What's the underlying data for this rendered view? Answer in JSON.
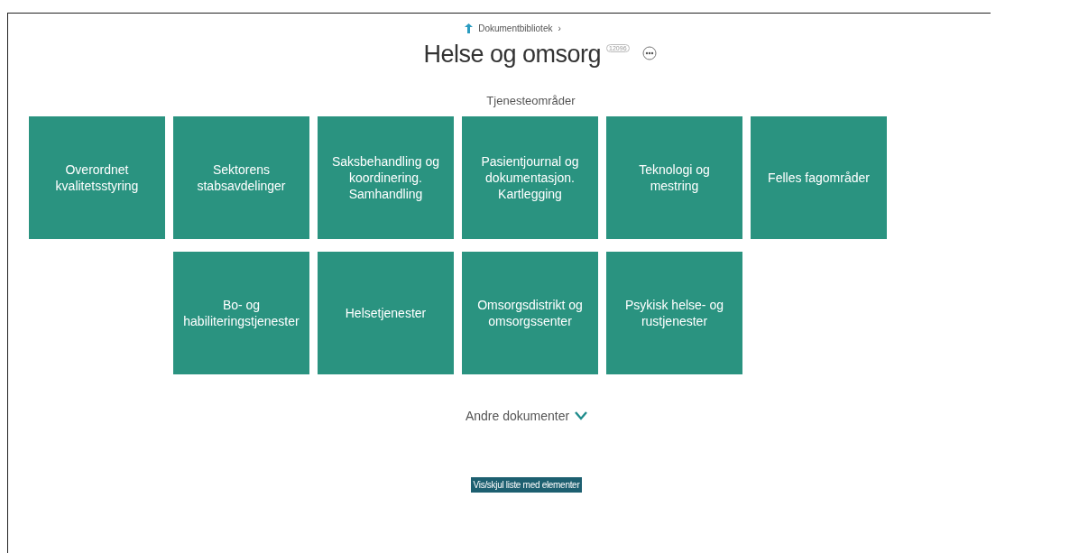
{
  "breadcrumb": {
    "label": "Dokumentbibliotek",
    "separator": "›"
  },
  "header": {
    "title": "Helse og omsorg",
    "badge": "12096"
  },
  "section": {
    "title": "Tjenesteområder",
    "rows": [
      {
        "tiles": [
          "Overordnet kvalitetsstyring",
          "Sektorens stabsavdelinger",
          "Saksbehandling og koordinering. Samhandling",
          "Pasientjournal og dokumentasjon. Kartlegging",
          "Teknologi og mestring",
          "Felles fagområder"
        ]
      },
      {
        "tiles": [
          "Bo- og habiliteringstjenester",
          "Helsetjenester",
          "Omsorgsdistrikt og omsorgssenter",
          "Psykisk helse- og rustjenester"
        ]
      }
    ]
  },
  "other_documents": {
    "label": "Andre dokumenter",
    "expanded": false
  },
  "toggle_button": {
    "label": "Vis/skjul liste med elementer"
  }
}
